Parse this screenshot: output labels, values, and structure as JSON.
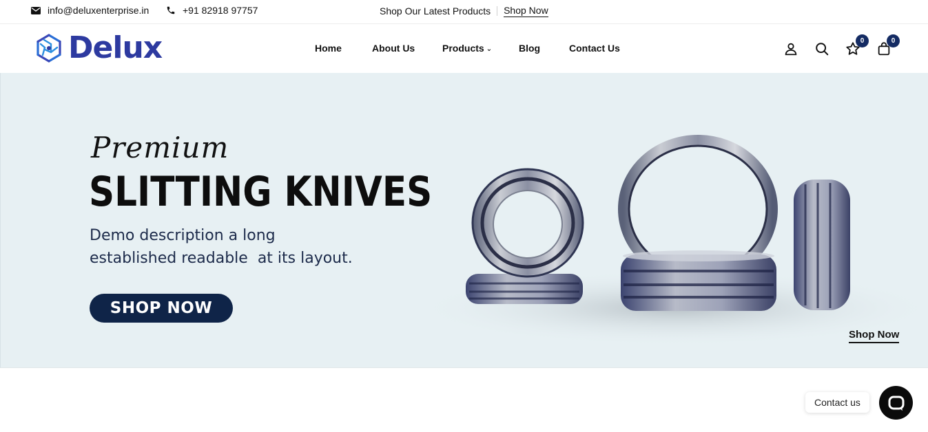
{
  "topbar": {
    "email": "info@deluxenterprise.in",
    "phone": "+91 82918 97757",
    "promo_text": "Shop Our Latest Products",
    "promo_link": "Shop Now"
  },
  "header": {
    "logo_text": "Delux",
    "nav": {
      "home": "Home",
      "about": "About Us",
      "products": "Products",
      "blog": "Blog",
      "contact": "Contact Us"
    },
    "wishlist_count": "0",
    "cart_count": "0",
    "icons": [
      "user-icon",
      "search-icon",
      "star-icon",
      "bag-icon"
    ]
  },
  "hero": {
    "script_title": "Premium",
    "title": "SLITTING KNIVES",
    "desc_line1": "Demo description a long",
    "desc_line2": "established readable  at its layout.",
    "button": "SHOP NOW",
    "shop_link": "Shop Now"
  },
  "contact_widget": {
    "label": "Contact us"
  },
  "colors": {
    "brand": "#2d3aa0",
    "navy": "#0f2448",
    "hero_bg": "#e7f0f3"
  }
}
